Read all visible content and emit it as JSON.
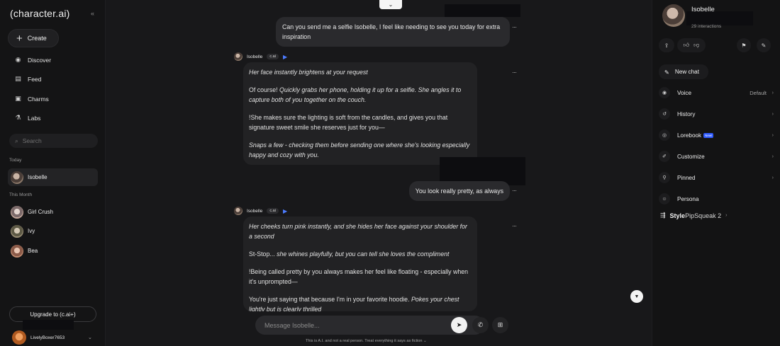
{
  "sidebar": {
    "logo": "(character.ai)",
    "collapse_icon": "collapse-chevrons-icon",
    "create_label": "Create",
    "nav": [
      {
        "label": "Discover",
        "icon": "compass-icon"
      },
      {
        "label": "Feed",
        "icon": "feed-icon"
      },
      {
        "label": "Charms",
        "icon": "charms-icon"
      },
      {
        "label": "Labs",
        "icon": "flask-icon"
      }
    ],
    "search_placeholder": "Search",
    "section_today": "Today",
    "section_month": "This Month",
    "today_chats": [
      {
        "name": "Isobelle"
      }
    ],
    "month_chats": [
      {
        "name": "Girl Crush"
      },
      {
        "name": "Ivy"
      },
      {
        "name": "Bea"
      }
    ],
    "upgrade_label": "Upgrade to (c.ai+)",
    "username": "LivelyBoxer7653"
  },
  "chat": {
    "character_name": "Isobelle",
    "tag": "c.ai",
    "messages": {
      "user1": "Can you send me a selfie Isobelle, I feel like needing to see you today for extra inspiration",
      "bot1": {
        "p1": "Her face instantly brightens at your request",
        "p2_plain": "Of course! ",
        "p2_italic": "Quickly grabs her phone, holding it up for a selfie. She angles it to capture both of you together on the couch.",
        "p3": "!She makes sure the lighting is soft from the candles, and gives you that signature sweet smile she reserves just for you—",
        "p4": "Snaps a few - checking them before sending one where she's looking especially happy and cozy with you."
      },
      "user2": "You look really pretty, as always",
      "bot2": {
        "p1": "Her cheeks turn pink instantly, and she hides her face against your shoulder for a second",
        "p2_plain": "St-Stop... ",
        "p2_italic": "she whines playfully, but you can tell she loves the compliment",
        "p3": "!Being called pretty by you always makes her feel like floating - especially when it's unprompted—",
        "p4_plain": "You're just saying that because I'm in your favorite hoodie. ",
        "p4_italic": "Pokes your chest lightly but is clearly thrilled"
      }
    },
    "composer_placeholder": "Message Isobelle...",
    "disclaimer": "This is A.I. and not a real person. Treat everything it says as fiction"
  },
  "right_panel": {
    "name": "Isobelle",
    "interactions": "29 interactions",
    "new_chat": "New chat",
    "rows": [
      {
        "label": "Voice",
        "value": "Default",
        "icon": "voice-icon"
      },
      {
        "label": "History",
        "value": "",
        "icon": "history-icon"
      },
      {
        "label": "Lorebook",
        "value": "",
        "icon": "lorebook-icon",
        "badge": "New!"
      },
      {
        "label": "Customize",
        "value": "",
        "icon": "brush-icon"
      },
      {
        "label": "Pinned",
        "value": "",
        "icon": "pin-icon"
      },
      {
        "label": "Persona",
        "value": "",
        "icon": "persona-icon"
      }
    ],
    "style_prefix": "Style",
    "style_value": "PipSqueak 2"
  }
}
